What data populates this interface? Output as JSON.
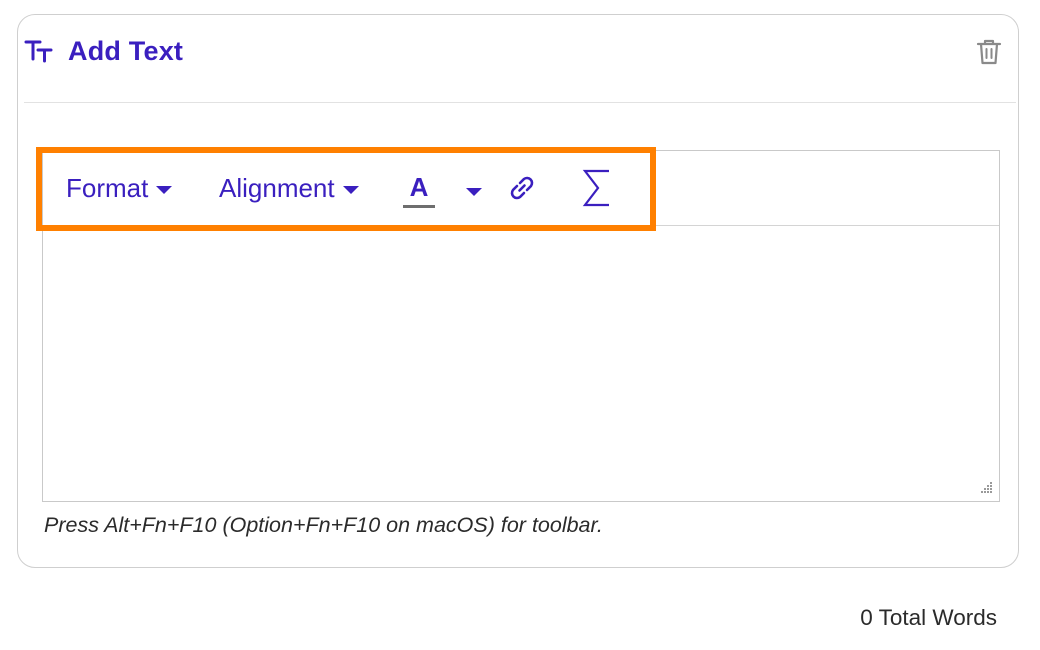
{
  "card": {
    "title": "Add Text",
    "title_icon": "text-size-icon",
    "delete_icon": "trash-icon"
  },
  "toolbar": {
    "format_label": "Format",
    "alignment_label": "Alignment",
    "font_color_letter": "A",
    "font_color_icon": "font-color-icon",
    "link_icon": "link-icon",
    "math_icon": "sigma-icon"
  },
  "editor": {
    "content": "",
    "hint": "Press Alt+Fn+F10 (Option+Fn+F10 on macOS) for toolbar."
  },
  "footer": {
    "word_count": "0 Total Words"
  },
  "colors": {
    "accent": "#3a1fbf",
    "highlight": "#ff8000",
    "border": "#cfcfcf"
  }
}
